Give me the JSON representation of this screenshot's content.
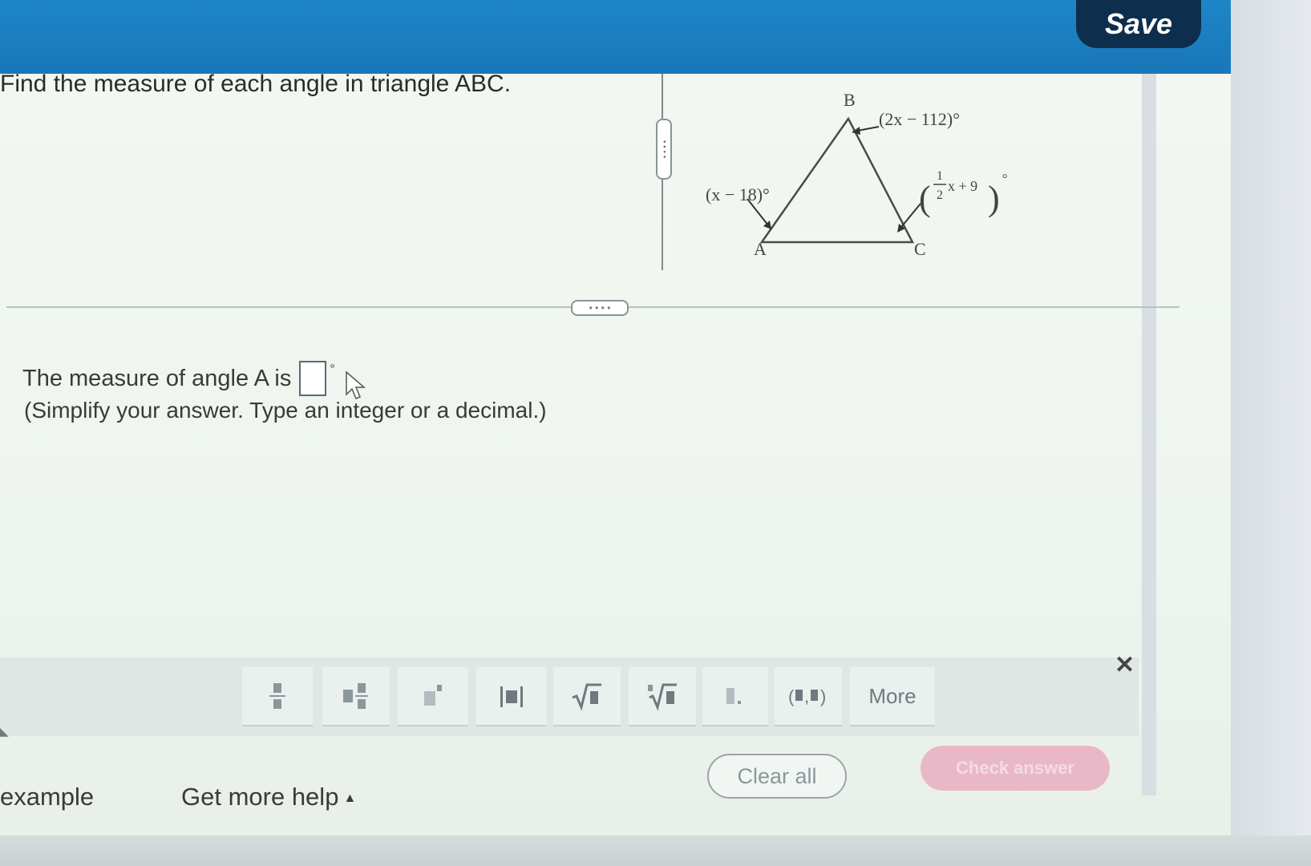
{
  "header": {
    "save_label": "Save"
  },
  "question": {
    "text": "Find the measure of each angle in triangle ABC."
  },
  "figure": {
    "vertex_a": "A",
    "vertex_b": "B",
    "vertex_c": "C",
    "angle_a_expr": "(x − 18)°",
    "angle_b_expr": "(2x − 112)°",
    "angle_c_frac_num": "1",
    "angle_c_frac_den": "2",
    "angle_c_rest": "x + 9",
    "angle_c_deg": "°"
  },
  "dividers": {
    "handle_glyph": "• • • •"
  },
  "answer": {
    "prefix": "The measure of angle A is",
    "value": "",
    "unit": "°",
    "hint": "(Simplify your answer. Type an integer or a decimal.)"
  },
  "toolbar": {
    "more_label": "More",
    "close_glyph": "✕",
    "tool_icons": [
      "fraction-icon",
      "mixed-number-icon",
      "exponent-icon",
      "absolute-value-icon",
      "square-root-icon",
      "nth-root-icon",
      "decimal-icon",
      "ordered-pair-icon"
    ]
  },
  "actions": {
    "clear_all_label": "Clear all",
    "check_answer_label": "Check answer"
  },
  "footer": {
    "example_label": "example",
    "help_label": "Get more help",
    "help_caret": "▲"
  },
  "colors": {
    "topbar": "#1977b8",
    "save_button": "#0d2e4c",
    "check_answer_disabled": "#e9b8c8"
  }
}
